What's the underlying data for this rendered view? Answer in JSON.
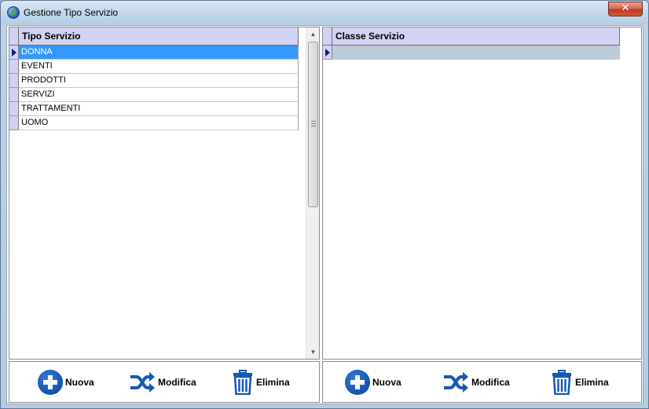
{
  "window": {
    "title": "Gestione Tipo Servizio",
    "close_glyph": "✕",
    "accent": "#3399ff",
    "header_color": "#d2d2f5"
  },
  "left_grid": {
    "column_header": "Tipo Servizio",
    "rows": [
      "DONNA",
      "EVENTI",
      "PRODOTTI",
      "SERVIZI",
      "TRATTAMENTI",
      "UOMO"
    ],
    "selected_index": 0
  },
  "right_grid": {
    "column_header": "Classe Servizio",
    "rows": []
  },
  "left_toolbar": {
    "new_label": "Nuova",
    "edit_label": "Modifica",
    "delete_label": "Elimina"
  },
  "right_toolbar": {
    "new_label": "Nuova",
    "edit_label": "Modifica",
    "delete_label": "Elimina"
  },
  "icons": {
    "app": "globe-icon",
    "new": "plus-circle-icon",
    "edit": "shuffle-icon",
    "delete": "trash-icon"
  }
}
